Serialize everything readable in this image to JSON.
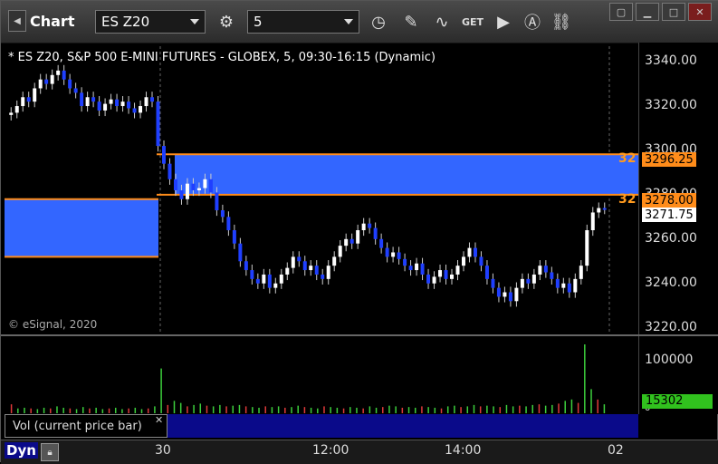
{
  "toolbar": {
    "app_title": "Chart",
    "symbol": "ES Z20",
    "interval": "5",
    "get_label": "GET",
    "icons": [
      "settings-gear-icon",
      "clock-icon",
      "pencil-icon",
      "indicator-icon",
      "get-data-icon",
      "play-icon",
      "alert-icon",
      "link-icon"
    ]
  },
  "window_buttons": [
    "restore",
    "minimize",
    "maximize",
    "close"
  ],
  "chart": {
    "info": "* ES Z20, S&P 500 E-MINI FUTURES - GLOBEX, 5, 09:30-16:15 (Dynamic)",
    "copyright": "© eSignal, 2020",
    "price_axis_ticks": [
      "3340.00",
      "3320.00",
      "3300.00",
      "3280.00",
      "3260.00",
      "3240.00",
      "3220.00"
    ],
    "level_upper": {
      "label": "32",
      "value": "3296.25"
    },
    "level_lower": {
      "label": "32",
      "value": "3278.00"
    },
    "last_price": "3271.75",
    "colors": {
      "zone": "#3366ff",
      "level_line": "#ff8c1a",
      "tag": "#ff8c1a",
      "up": "#ffffff",
      "down": "#1f3fff"
    }
  },
  "volume": {
    "legend": "Vol (current price bar)",
    "axis_tick": "100000",
    "axis_small": "0",
    "current_value": "15302"
  },
  "time_axis": {
    "labels": [
      "30",
      "12:00",
      "14:00",
      "02"
    ],
    "dyn_label": "Dyn"
  },
  "chart_data": {
    "type": "candlestick",
    "ylim": [
      3215,
      3345
    ],
    "zones": [
      {
        "from": 3278.0,
        "to": 3296.25
      },
      {
        "from": 3250.0,
        "to": 3276.0
      }
    ],
    "closes": [
      3315,
      3318,
      3322,
      3320,
      3326,
      3330,
      3328,
      3332,
      3334,
      3330,
      3326,
      3324,
      3318,
      3322,
      3320,
      3316,
      3319,
      3321,
      3318,
      3320,
      3317,
      3315,
      3318,
      3322,
      3320,
      3300,
      3292,
      3285,
      3280,
      3276,
      3283,
      3280,
      3281,
      3285,
      3279,
      3271,
      3268,
      3262,
      3256,
      3248,
      3244,
      3240,
      3238,
      3242,
      3236,
      3238,
      3242,
      3245,
      3250,
      3248,
      3244,
      3246,
      3242,
      3240,
      3246,
      3250,
      3255,
      3258,
      3256,
      3262,
      3265,
      3263,
      3258,
      3254,
      3250,
      3252,
      3249,
      3246,
      3244,
      3247,
      3242,
      3238,
      3241,
      3244,
      3240,
      3242,
      3246,
      3250,
      3254,
      3250,
      3246,
      3240,
      3236,
      3232,
      3234,
      3230,
      3236,
      3240,
      3238,
      3242,
      3246,
      3243,
      3240,
      3236,
      3238,
      3234,
      3240,
      3246,
      3262,
      3270,
      3272,
      3271.75
    ],
    "volumes": [
      0.13,
      0.07,
      0.08,
      0.07,
      0.06,
      0.08,
      0.07,
      0.1,
      0.08,
      0.07,
      0.06,
      0.09,
      0.07,
      0.08,
      0.06,
      0.07,
      0.08,
      0.06,
      0.07,
      0.08,
      0.06,
      0.07,
      0.1,
      0.65,
      0.12,
      0.18,
      0.15,
      0.1,
      0.12,
      0.14,
      0.11,
      0.1,
      0.12,
      0.1,
      0.11,
      0.12,
      0.1,
      0.09,
      0.08,
      0.1,
      0.09,
      0.1,
      0.08,
      0.09,
      0.11,
      0.09,
      0.08,
      0.07,
      0.1,
      0.09,
      0.08,
      0.07,
      0.09,
      0.08,
      0.07,
      0.1,
      0.08,
      0.09,
      0.11,
      0.1,
      0.08,
      0.09,
      0.08,
      0.1,
      0.09,
      0.08,
      0.07,
      0.1,
      0.11,
      0.09,
      0.1,
      0.12,
      0.1,
      0.11,
      0.1,
      0.09,
      0.12,
      0.1,
      0.11,
      0.1,
      0.12,
      0.13,
      0.11,
      0.12,
      0.14,
      0.18,
      0.2,
      0.15,
      1.0,
      0.35,
      0.2,
      0.13
    ]
  }
}
